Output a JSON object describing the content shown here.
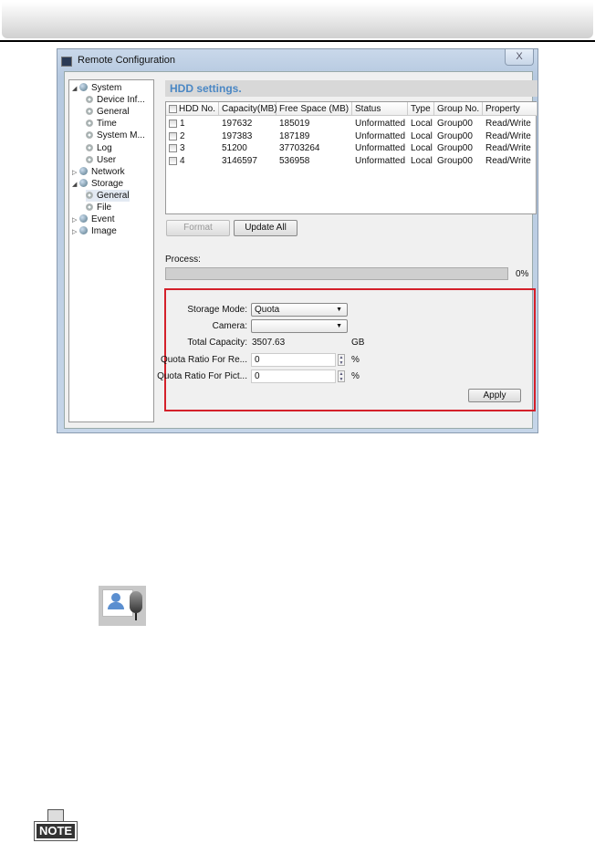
{
  "window": {
    "title": "Remote Configuration",
    "close_label": "X"
  },
  "tree": [
    {
      "label": "System",
      "level": 0,
      "expanded": true,
      "icon": "globe-icon"
    },
    {
      "label": "Device Inf...",
      "level": 1,
      "icon": "gear-icon"
    },
    {
      "label": "General",
      "level": 1,
      "icon": "gear-icon"
    },
    {
      "label": "Time",
      "level": 1,
      "icon": "gear-icon"
    },
    {
      "label": "System M...",
      "level": 1,
      "icon": "gear-icon"
    },
    {
      "label": "Log",
      "level": 1,
      "icon": "gear-icon"
    },
    {
      "label": "User",
      "level": 1,
      "icon": "gear-icon"
    },
    {
      "label": "Network",
      "level": 0,
      "expanded": false,
      "icon": "globe-icon"
    },
    {
      "label": "Storage",
      "level": 0,
      "expanded": true,
      "icon": "globe-icon"
    },
    {
      "label": "General",
      "level": 1,
      "icon": "gear-icon",
      "selected": true
    },
    {
      "label": "File",
      "level": 1,
      "icon": "gear-icon"
    },
    {
      "label": "Event",
      "level": 0,
      "expanded": false,
      "icon": "globe-icon"
    },
    {
      "label": "Image",
      "level": 0,
      "expanded": false,
      "icon": "globe-icon"
    }
  ],
  "hdd": {
    "title": "HDD settings.",
    "columns": [
      "HDD No.",
      "Capacity(MB)",
      "Free Space (MB)",
      "Status",
      "Type",
      "Group No.",
      "Property"
    ],
    "rows": [
      [
        "1",
        "197632",
        "185019",
        "Unformatted",
        "Local",
        "Group00",
        "Read/Write"
      ],
      [
        "2",
        "197383",
        "187189",
        "Unformatted",
        "Local",
        "Group00",
        "Read/Write"
      ],
      [
        "3",
        "51200",
        "37703264",
        "Unformatted",
        "Local",
        "Group00",
        "Read/Write"
      ],
      [
        "4",
        "3146597",
        "536958",
        "Unformatted",
        "Local",
        "Group00",
        "Read/Write"
      ]
    ],
    "format_label": "Format",
    "update_all_label": "Update All"
  },
  "process": {
    "label": "Process:",
    "percent_label": "0%",
    "value": 0
  },
  "storage": {
    "mode_label": "Storage Mode:",
    "mode_value": "Quota",
    "camera_label": "Camera:",
    "camera_value": "",
    "total_label": "Total Capacity:",
    "total_value": "3507.63",
    "total_unit": "GB",
    "quota_record_label": "Quota Ratio For Re...",
    "quota_record_value": "0",
    "quota_picture_label": "Quota Ratio For Pict...",
    "quota_picture_value": "0",
    "percent_unit": "%",
    "apply_label": "Apply",
    "highlight_color": "#d4202a"
  },
  "note_icon": "NOTE"
}
